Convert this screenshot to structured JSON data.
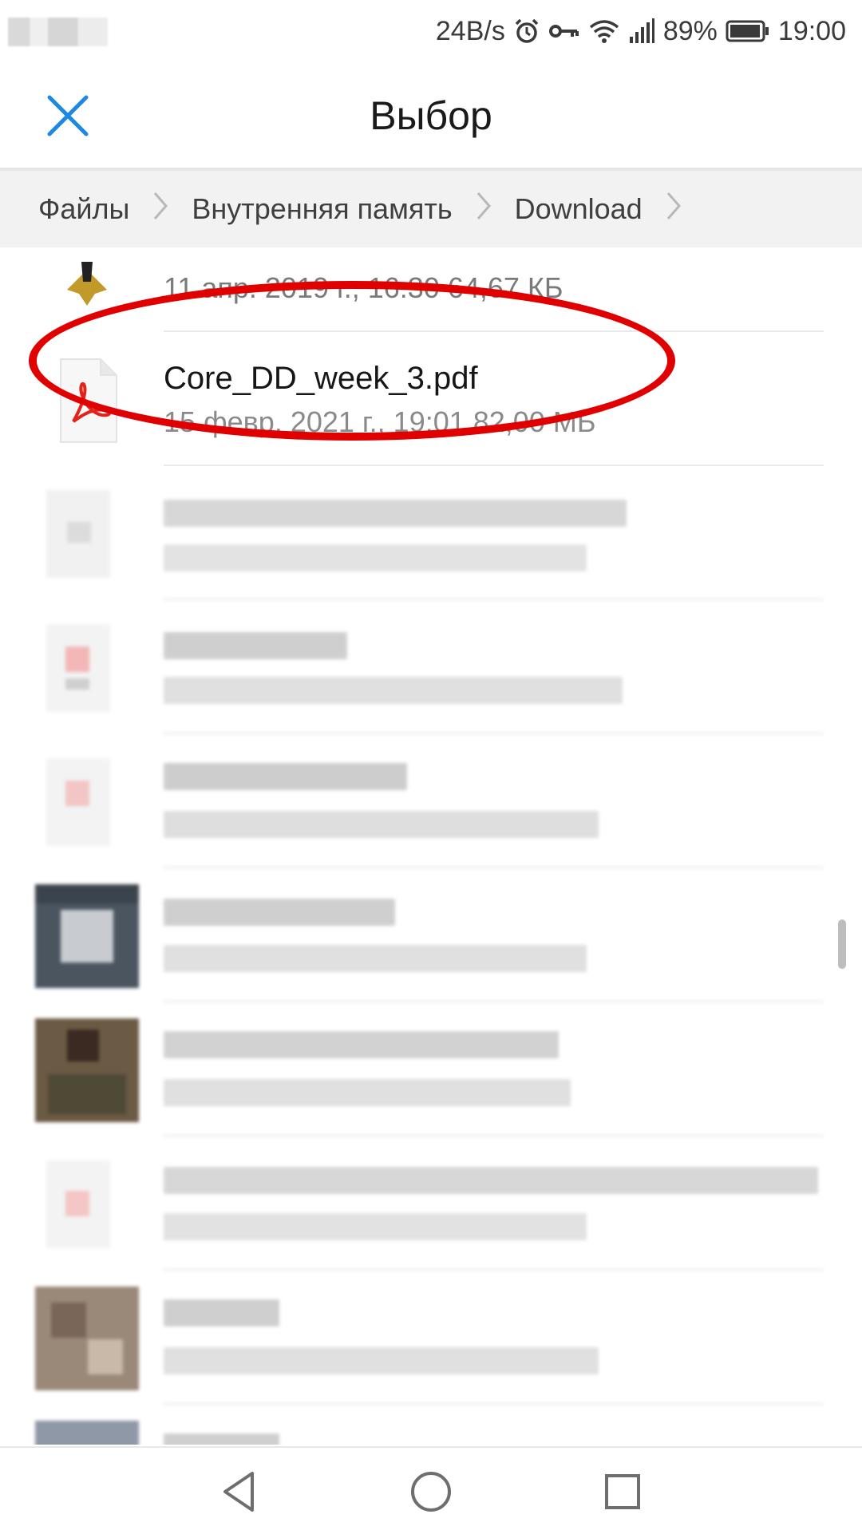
{
  "status_bar": {
    "net_speed": "24B/s",
    "battery": "89%",
    "time": "19:00",
    "icons": [
      "alarm-icon",
      "key-icon",
      "wifi-icon",
      "signal-icon",
      "battery-icon"
    ]
  },
  "app_bar": {
    "title": "Выбор",
    "close_icon": "close-icon",
    "accent_color": "#1e88e5"
  },
  "breadcrumb": {
    "items": [
      "Файлы",
      "Внутренняя память",
      "Download"
    ],
    "separator_icon": "chevron-right-icon"
  },
  "files": [
    {
      "name": "",
      "meta": "11 апр. 2019 г., 16:30 64,67 КБ",
      "icon": "image-thumbnail",
      "partially_visible": true
    },
    {
      "name": "Core_DD_week_3.pdf",
      "meta": "15 февр. 2021 г., 19:01 82,00 МБ",
      "icon": "pdf-file-icon",
      "highlighted": true
    },
    {
      "name": "",
      "meta": "",
      "icon": "file-icon",
      "blurred": true
    },
    {
      "name": "",
      "meta": "",
      "icon": "pdf-file-icon",
      "blurred": true
    },
    {
      "name": "",
      "meta": "",
      "icon": "pdf-file-icon",
      "blurred": true
    },
    {
      "name": "",
      "meta": "",
      "icon": "image-thumbnail",
      "blurred": true
    },
    {
      "name": "",
      "meta": "",
      "icon": "image-thumbnail",
      "blurred": true
    },
    {
      "name": "",
      "meta": "",
      "icon": "pdf-file-icon",
      "blurred": true
    },
    {
      "name": "",
      "meta": "",
      "icon": "image-thumbnail",
      "blurred": true
    },
    {
      "name": "",
      "meta": "",
      "icon": "image-thumbnail",
      "blurred": true
    }
  ],
  "highlight_color": "#e00000",
  "nav_bar": {
    "buttons": [
      "back-icon",
      "home-icon",
      "recents-icon"
    ]
  }
}
